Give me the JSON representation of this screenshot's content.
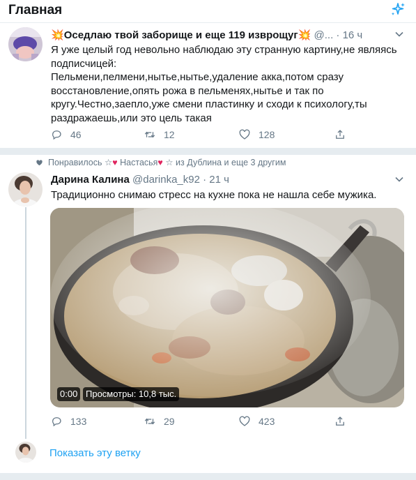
{
  "header": {
    "title": "Главная",
    "sparkle_icon": "sparkle-icon"
  },
  "colors": {
    "accent": "#1da1f2",
    "secondary_text": "#657786",
    "like_heart": "#e0245e",
    "divider": "#e6ecf0"
  },
  "tweet1": {
    "emoji_left": "💥",
    "name": "Оседлаю твой заборище и еще 119 изврощуг",
    "emoji_right": "💥",
    "handle": "@...",
    "time": "· 16 ч",
    "text_lines": [
      "Я уже целый год невольно наблюдаю эту странную картину,не являясь",
      "подписчицей:",
      "Пельмени,пелмени,нытье,нытье,удаление акка,потом сразу",
      "восстановление,опять рожа в пельменях,нытье и так по",
      "кругу.Честно,заепло,уже смени пластинку и сходи к психологу,ты",
      "раздражаешь,или это цель такая"
    ],
    "replies": "46",
    "retweets": "12",
    "likes": "128"
  },
  "tweet2": {
    "social_context": {
      "prefix": "Понравилось",
      "star1": "☆",
      "heart1": "♥",
      "name1": "Настасья",
      "heart2": "♥",
      "star2": "☆",
      "suffix": "из Дублина и еще 3 другим"
    },
    "name": "Дарина Калина",
    "handle": "@darinka_k92",
    "time": "· 21 ч",
    "text": "Традиционно снимаю стресс на кухне пока не нашла себе мужика.",
    "video_time": "0:00",
    "video_views": "Просмотры: 10,8 тыс.",
    "replies": "133",
    "retweets": "29",
    "likes": "423"
  },
  "show_thread": "Показать эту ветку"
}
